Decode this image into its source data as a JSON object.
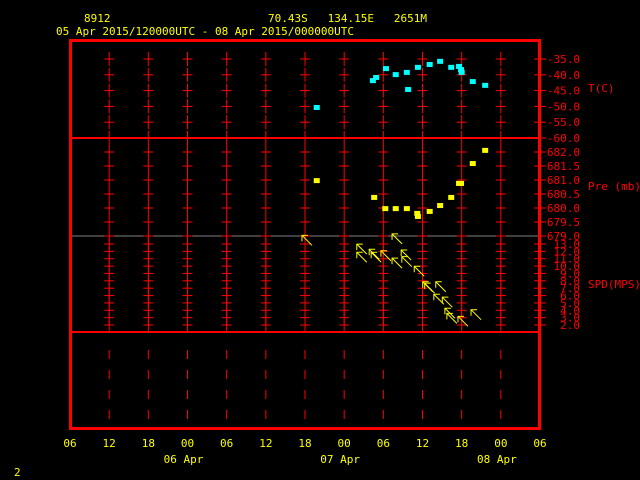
{
  "header": {
    "station": "8912",
    "location": "70.43S   134.15E   2651M",
    "period": "05 Apr 2015/120000UTC - 08 Apr 2015/000000UTC"
  },
  "footer": {
    "page": "2"
  },
  "colors": {
    "frame": "#ff0000",
    "text": "#ffff00",
    "temperature": "#00ffff",
    "pressure": "#ffff00",
    "wind": "#ffff00"
  },
  "chart_data": [
    {
      "type": "scatter",
      "title": "T(C)",
      "ylabel": "T(C)",
      "ylim": [
        -60,
        -35
      ],
      "yticks": [
        "-35.0",
        "-40.0",
        "-45.0",
        "-50.0",
        "-55.0",
        "-60.0"
      ],
      "x_units": "hours since 05 Apr 06UTC",
      "points": [
        [
          37.8,
          -50.5
        ],
        [
          46.4,
          -42.0
        ],
        [
          46.9,
          -41.0
        ],
        [
          48.4,
          -38.2
        ],
        [
          49.9,
          -40.1
        ],
        [
          51.6,
          -39.4
        ],
        [
          51.8,
          -44.8
        ],
        [
          53.3,
          -37.8
        ],
        [
          55.1,
          -36.9
        ],
        [
          56.7,
          -35.9
        ],
        [
          58.4,
          -37.8
        ],
        [
          59.6,
          -37.5
        ],
        [
          59.9,
          -38.5
        ],
        [
          60.0,
          -39.4
        ],
        [
          61.7,
          -42.3
        ],
        [
          63.6,
          -43.5
        ]
      ]
    },
    {
      "type": "scatter",
      "title": "Pre (mb)",
      "ylabel": "Pre (mb)",
      "ylim": [
        679,
        682.25
      ],
      "yticks": [
        "682.0",
        "681.5",
        "681.0",
        "680.5",
        "680.0",
        "679.5",
        "679.0"
      ],
      "points": [
        [
          37.8,
          680.96
        ],
        [
          46.6,
          680.36
        ],
        [
          48.3,
          679.96
        ],
        [
          49.9,
          679.96
        ],
        [
          51.6,
          679.96
        ],
        [
          53.2,
          679.79
        ],
        [
          53.3,
          679.68
        ],
        [
          55.1,
          679.86
        ],
        [
          56.7,
          680.07
        ],
        [
          58.4,
          680.36
        ],
        [
          59.6,
          680.86
        ],
        [
          59.9,
          680.86
        ],
        [
          61.7,
          681.57
        ],
        [
          63.6,
          682.04
        ]
      ]
    },
    {
      "type": "scatter",
      "title": "SPD(MPS)",
      "ylabel": "SPD(MPS)",
      "ylim": [
        2,
        13
      ],
      "yticks": [
        "13.0",
        "12.0",
        "11.0",
        "10.0",
        "9.0",
        "8.0",
        "7.0",
        "6.0",
        "5.0",
        "4.0",
        "3.0",
        "2.0"
      ],
      "marker": "wind-arrow from SE",
      "points": [
        [
          36.3,
          13.5
        ],
        [
          50.1,
          13.7
        ],
        [
          44.7,
          12.3
        ],
        [
          44.7,
          11.2
        ],
        [
          46.6,
          11.6
        ],
        [
          46.9,
          11.2
        ],
        [
          48.4,
          11.4
        ],
        [
          50.1,
          10.4
        ],
        [
          51.5,
          11.5
        ],
        [
          51.6,
          10.6
        ],
        [
          53.5,
          9.3
        ],
        [
          54.8,
          7.2
        ],
        [
          55.1,
          7.0
        ],
        [
          56.8,
          7.2
        ],
        [
          56.5,
          5.5
        ],
        [
          57.8,
          5.1
        ],
        [
          58.2,
          3.6
        ],
        [
          58.5,
          2.9
        ],
        [
          60.2,
          2.5
        ],
        [
          62.2,
          3.4
        ]
      ]
    }
  ],
  "xaxis": {
    "ticks": [
      "06",
      "12",
      "18",
      "00",
      "06",
      "12",
      "18",
      "00",
      "06",
      "12",
      "18",
      "00",
      "06"
    ],
    "dates": [
      {
        "label": "06 Apr",
        "at": 3
      },
      {
        "label": "07 Apr",
        "at": 7
      },
      {
        "label": "08 Apr",
        "at": 11
      }
    ]
  }
}
